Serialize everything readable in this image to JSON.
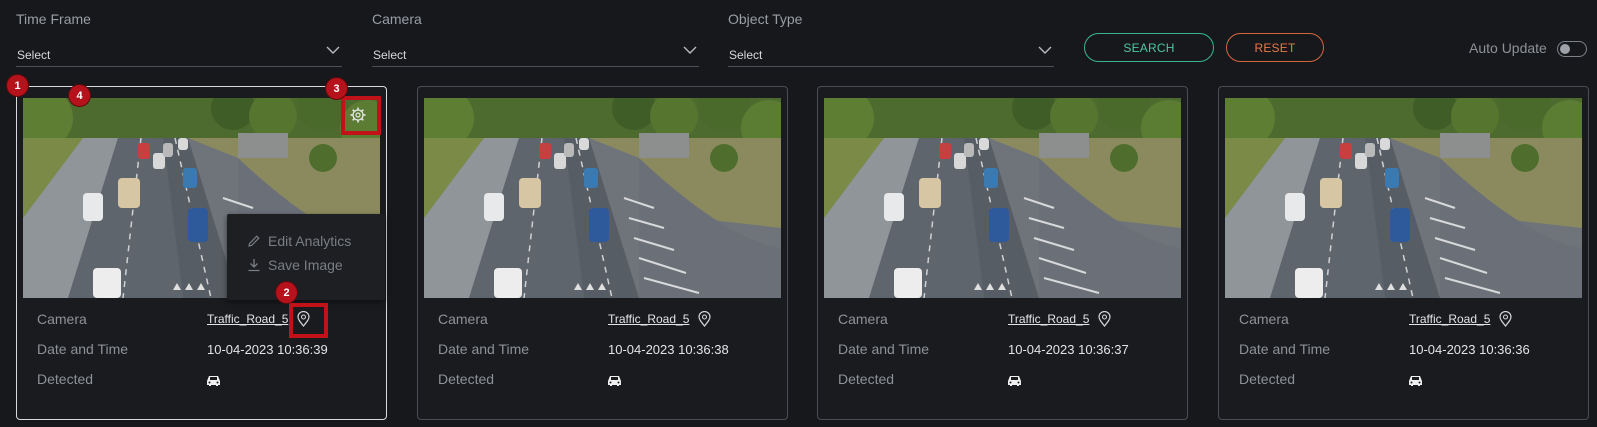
{
  "filters": {
    "time_frame": {
      "label": "Time Frame",
      "value": "Select"
    },
    "camera": {
      "label": "Camera",
      "value": "Select"
    },
    "object_type": {
      "label": "Object Type",
      "value": "Select"
    }
  },
  "actions": {
    "search_label": "SEARCH",
    "reset_label": "RESET"
  },
  "auto_update": {
    "label": "Auto Update",
    "enabled": false
  },
  "field_labels": {
    "camera": "Camera",
    "date_time": "Date and Time",
    "detected": "Detected"
  },
  "cards": [
    {
      "camera": "Traffic_Road_5",
      "datetime": "10-04-2023 10:36:39",
      "detected_icon": "car-icon"
    },
    {
      "camera": "Traffic_Road_5",
      "datetime": "10-04-2023 10:36:38",
      "detected_icon": "car-icon"
    },
    {
      "camera": "Traffic_Road_5",
      "datetime": "10-04-2023 10:36:37",
      "detected_icon": "car-icon"
    },
    {
      "camera": "Traffic_Road_5",
      "datetime": "10-04-2023 10:36:36",
      "detected_icon": "car-icon"
    }
  ],
  "context_menu": {
    "edit_label": "Edit Analytics",
    "save_label": "Save Image"
  },
  "annotations": [
    "1",
    "2",
    "3",
    "4"
  ],
  "colors": {
    "background": "#16181c",
    "search_accent": "#39b48f",
    "reset_accent": "#d2673d",
    "annotation_red": "#c1121a"
  }
}
